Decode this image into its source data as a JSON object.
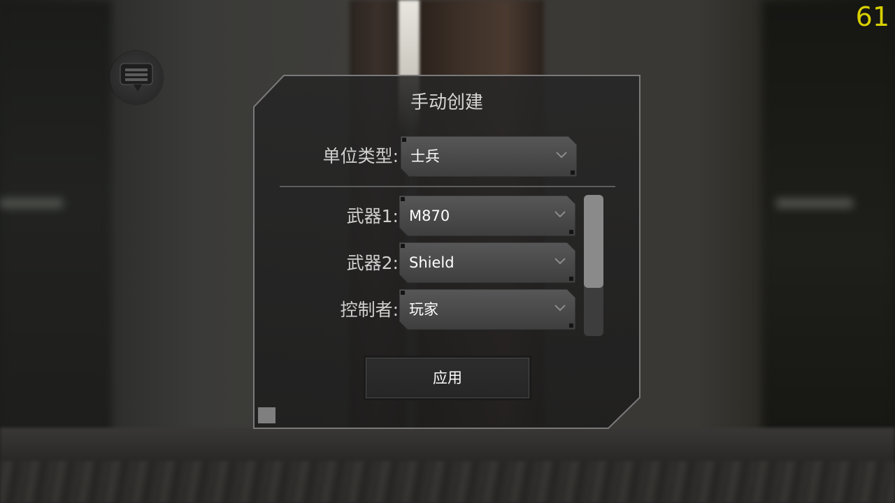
{
  "hud": {
    "fps": "61"
  },
  "dialog": {
    "title": "手动创建",
    "unit_type": {
      "label": "单位类型:",
      "value": "士兵"
    },
    "fields": [
      {
        "label": "武器1:",
        "value": "M870"
      },
      {
        "label": "武器2:",
        "value": "Shield"
      },
      {
        "label": "控制者:",
        "value": "玩家"
      }
    ],
    "apply_label": "应用",
    "scrollbar_thumb_fraction": 0.66
  },
  "icons": {
    "chat": "chat-bubble-icon",
    "dropdown_caret": "chevron-down-icon"
  },
  "colors": {
    "fps": "#d8d000",
    "panel_border": "#7a7a7a",
    "dropdown_fill": "#4a4a4a",
    "text": "#ffffff",
    "label": "#d0d0d0"
  }
}
